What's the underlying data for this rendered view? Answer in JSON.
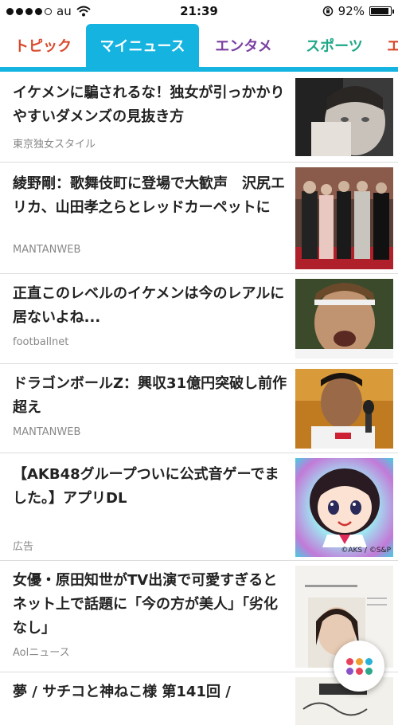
{
  "status_bar": {
    "carrier": "au",
    "time": "21:39",
    "battery_percent": "92%",
    "battery_level": 0.92,
    "signal_bars": 4
  },
  "tabs": [
    {
      "label": "トピック",
      "color": "#d9482b",
      "active": false
    },
    {
      "label": "マイニュース",
      "color": "#ffffff",
      "active": true
    },
    {
      "label": "エンタメ",
      "color": "#7b3fa0",
      "active": false
    },
    {
      "label": "スポーツ",
      "color": "#1fa888",
      "active": false
    },
    {
      "label": "エ",
      "color": "#d9482b",
      "active": false
    }
  ],
  "accent_color": "#14b3e0",
  "articles": [
    {
      "title": "イケメンに騙されるな！独女が引っかかりやすいダメンズの見抜き方",
      "source": "東京独女スタイル"
    },
    {
      "title": "綾野剛：歌舞伎町に登場で大歓声　沢尻エリカ、山田孝之らとレッドカーペットに",
      "source": "MANTANWEB"
    },
    {
      "title": "正直このレベルのイケメンは今のレアルに居ないよね...",
      "source": "footballnet"
    },
    {
      "title": "ドラゴンボールZ：興収31億円突破し前作超え",
      "source": "MANTANWEB"
    },
    {
      "title": "【AKB48グループついに公式音ゲーでました。】アプリDL",
      "source": "広告",
      "thumb_caption": "©AKS / ©S&P"
    },
    {
      "title": "女優・原田知世がTV出演で可愛すぎるとネット上で話題に「今の方が美人」「劣化なし」",
      "source": "Aolニュース"
    },
    {
      "title": "夢 / サチコと神ねこ様 第141回 /",
      "source": ""
    }
  ],
  "fab_dot_colors": [
    "#e8425a",
    "#f0a030",
    "#2bb0d8",
    "#8a52c8",
    "#e8425a",
    "#2aa889"
  ]
}
